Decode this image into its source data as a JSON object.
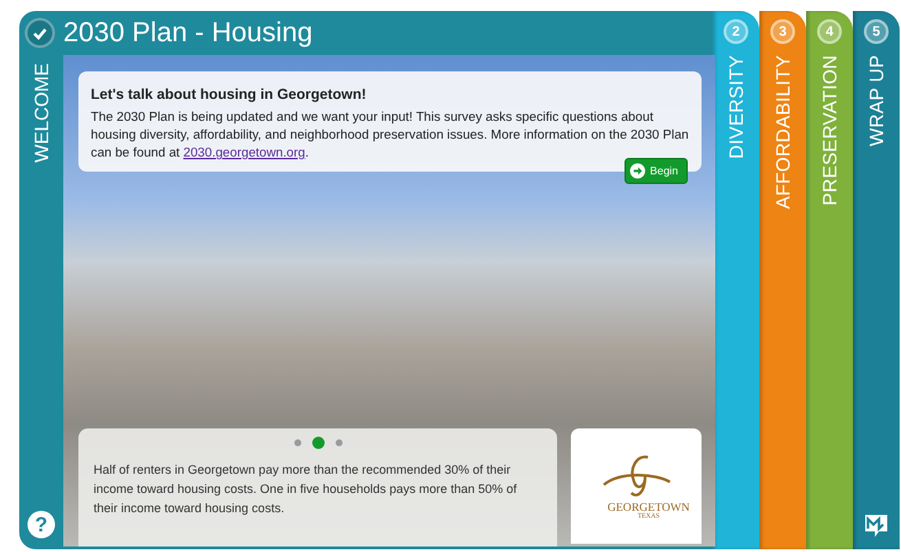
{
  "title": "2030 Plan - Housing",
  "welcome_tab": {
    "label": "WELCOME",
    "completed": true
  },
  "tabs": [
    {
      "number": "2",
      "label": "DIVERSITY",
      "color": "#1fb4d8"
    },
    {
      "number": "3",
      "label": "AFFORDABILITY",
      "color": "#ee8413"
    },
    {
      "number": "4",
      "label": "PRESERVATION",
      "color": "#7fb13b"
    },
    {
      "number": "5",
      "label": "WRAP UP",
      "color": "#1c8196"
    }
  ],
  "intro": {
    "heading": "Let's talk about housing in Georgetown!",
    "body": "The 2030 Plan is being updated and we want your input! This survey asks specific questions about housing diversity, affordability, and neighborhood preservation issues. More information on the 2030 Plan can be found at ",
    "link": "2030.georgetown.org",
    "after_link": ".",
    "button": "Begin"
  },
  "carousel": {
    "dots": [
      {
        "selected": false
      },
      {
        "selected": true
      },
      {
        "selected": false
      }
    ],
    "caption": "Half of renters in Georgetown pay more than the recommended 30% of their income toward housing costs.  One in five households pays more than 50% of their income toward housing costs."
  },
  "logo": {
    "name": "GEORGETOWN",
    "region": "TEXAS"
  },
  "help_button": "?"
}
